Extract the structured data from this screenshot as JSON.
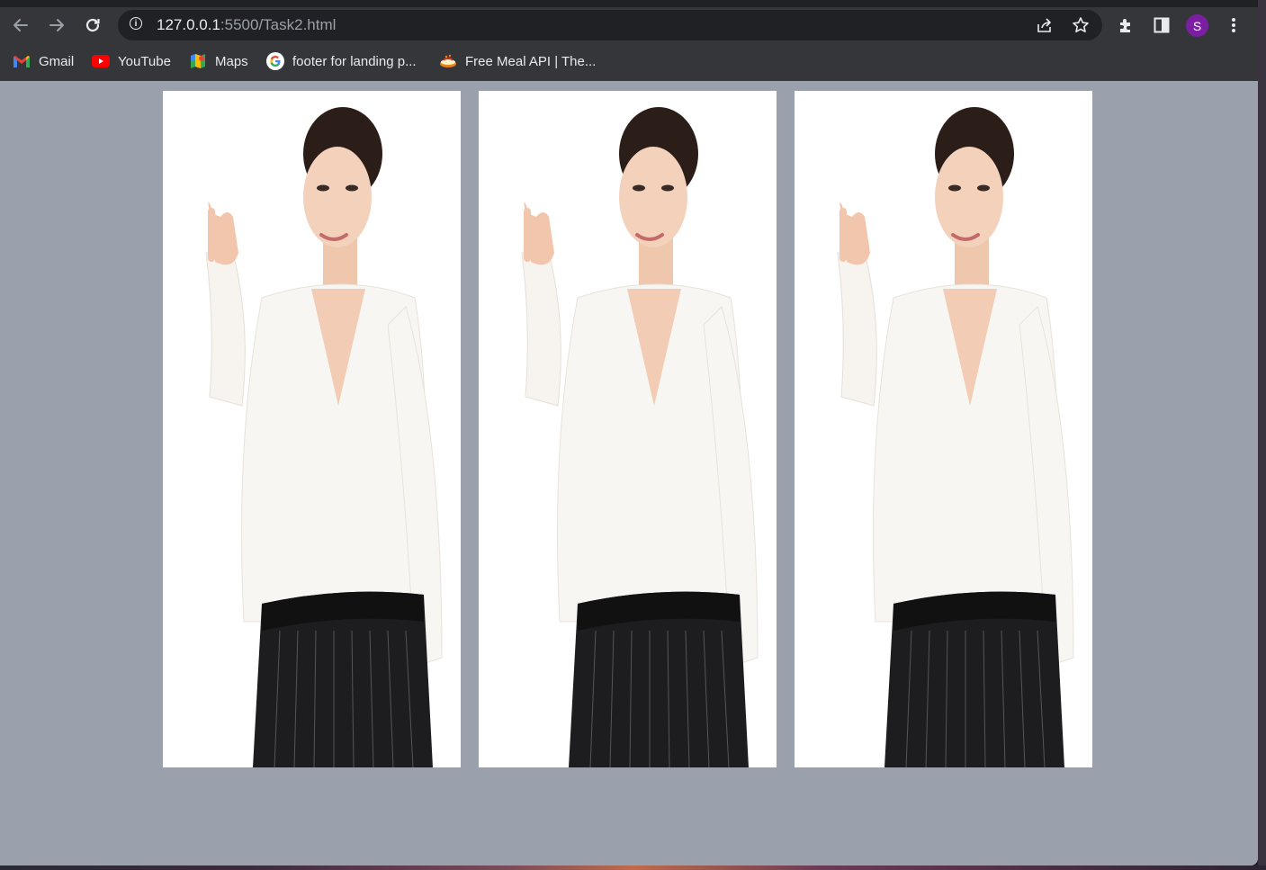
{
  "browser": {
    "url_host": "127.0.0.1",
    "url_rest": ":5500/Task2.html",
    "profile_initial": "S",
    "nav": {
      "back_icon": "arrow-left-icon",
      "forward_icon": "arrow-right-icon",
      "reload_icon": "reload-icon"
    },
    "omnibox_icons": [
      "info-icon",
      "share-icon",
      "star-icon"
    ],
    "toolbar_icons": [
      "extensions-icon",
      "side-panel-icon",
      "menu-kebab-icon"
    ]
  },
  "bookmarks": [
    {
      "label": "Gmail",
      "icon": "gmail-icon"
    },
    {
      "label": "YouTube",
      "icon": "youtube-icon"
    },
    {
      "label": "Maps",
      "icon": "maps-icon"
    },
    {
      "label": "footer for landing p...",
      "icon": "google-icon"
    },
    {
      "label": "Free Meal API | The...",
      "icon": "meal-icon"
    }
  ],
  "page": {
    "background_color": "#9aa1ad",
    "cards": [
      {
        "image": "woman-pointing-up-photo"
      },
      {
        "image": "woman-pointing-up-photo"
      },
      {
        "image": "woman-pointing-up-photo"
      }
    ]
  },
  "colors": {
    "chrome_dark": "#35363a",
    "omnibox": "#202124",
    "avatar": "#7b1fa2",
    "youtube_red": "#ff0000"
  }
}
